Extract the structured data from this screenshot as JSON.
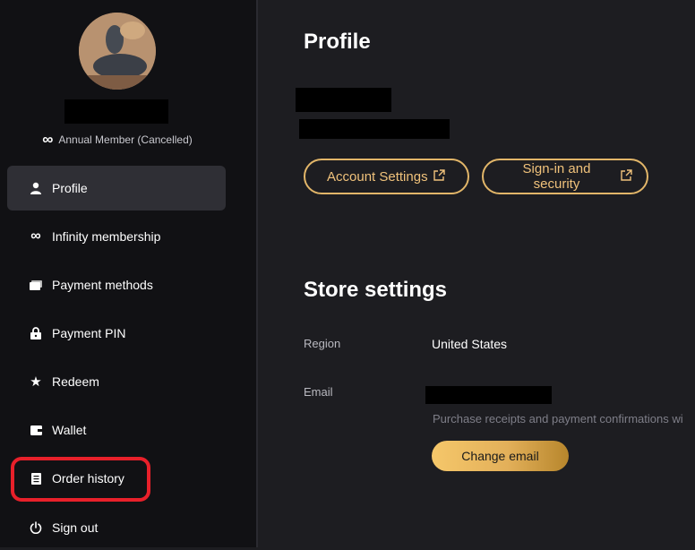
{
  "sidebar": {
    "membership_icon": "infinity-icon",
    "membership_text": "Annual Member (Cancelled)",
    "items": [
      {
        "label": "Profile",
        "icon": "user-icon"
      },
      {
        "label": "Infinity membership",
        "icon": "infinity-icon"
      },
      {
        "label": "Payment methods",
        "icon": "card-icon"
      },
      {
        "label": "Payment PIN",
        "icon": "lock-icon"
      },
      {
        "label": "Redeem",
        "icon": "star-icon"
      },
      {
        "label": "Wallet",
        "icon": "wallet-icon"
      },
      {
        "label": "Order history",
        "icon": "receipt-icon"
      },
      {
        "label": "Sign out",
        "icon": "power-icon"
      }
    ]
  },
  "main": {
    "profile_title": "Profile",
    "account_settings_label": "Account Settings",
    "signin_security_label": "Sign-in and security",
    "store_settings_title": "Store settings",
    "region_label": "Region",
    "region_value": "United States",
    "email_label": "Email",
    "email_hint": "Purchase receipts and payment confirmations wi",
    "change_email_label": "Change email"
  },
  "colors": {
    "accent_gold": "#e2b669",
    "highlight_red": "#e8202a",
    "sidebar_bg": "#111114",
    "main_bg": "#1d1d21"
  }
}
